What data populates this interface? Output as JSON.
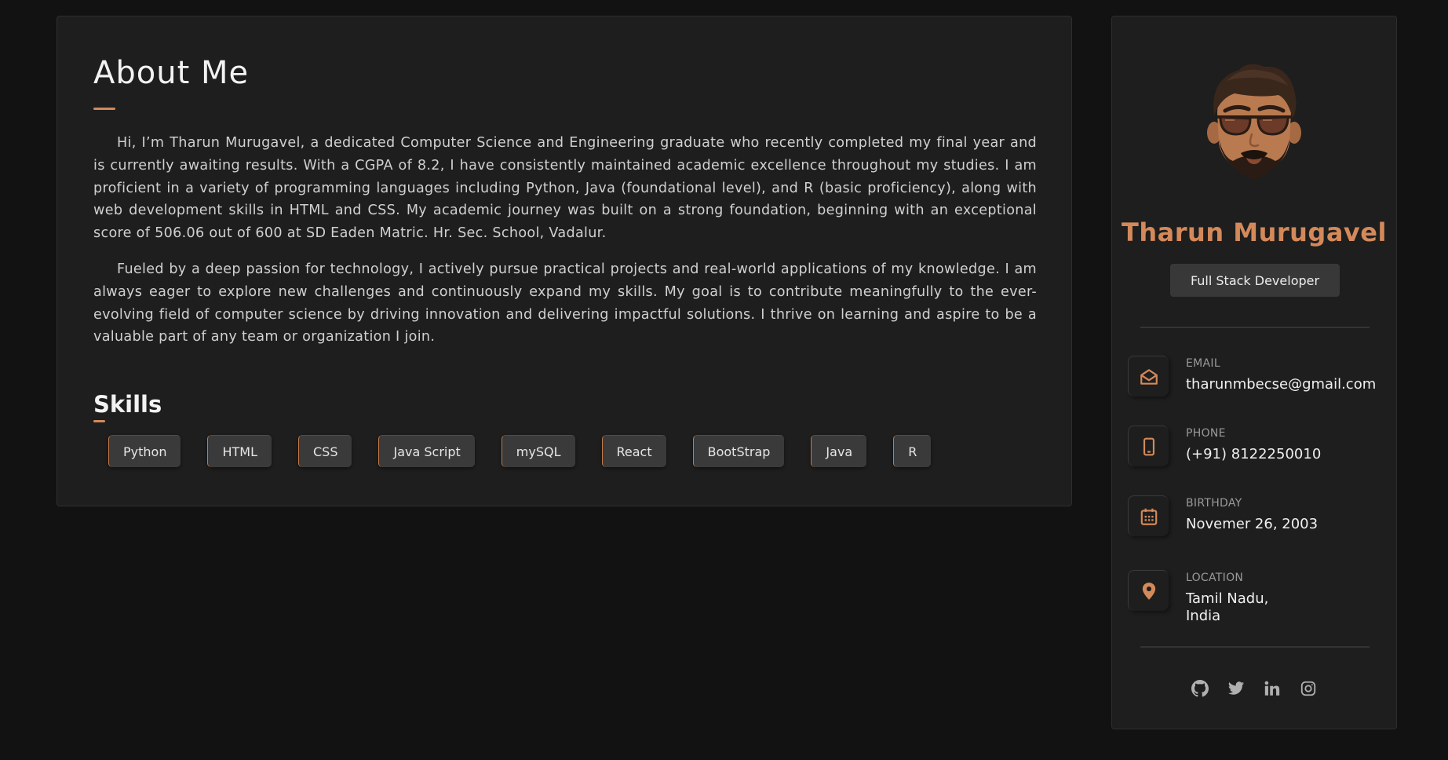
{
  "about": {
    "title": "About Me",
    "paragraphs": [
      "Hi, I’m Tharun Murugavel, a dedicated Computer Science and Engineering graduate who recently completed my final year and is currently awaiting results. With a CGPA of 8.2, I have consistently maintained academic excellence throughout my studies. I am proficient in a variety of programming languages including Python, Java (foundational level), and R (basic proficiency), along with web development skills in HTML and CSS. My academic journey was built on a strong foundation, beginning with an exceptional score of 506.06 out of 600 at SD Eaden Matric. Hr. Sec. School, Vadalur.",
      "Fueled by a deep passion for technology, I actively pursue practical projects and real-world applications of my knowledge. I am always eager to explore new challenges and continuously expand my skills. My goal is to contribute meaningfully to the ever-evolving field of computer science by driving innovation and delivering impactful solutions. I thrive on learning and aspire to be a valuable part of any team or organization I join."
    ]
  },
  "skills": {
    "title": "Skills",
    "items": [
      "Python",
      "HTML",
      "CSS",
      "Java Script",
      "mySQL",
      "React",
      "BootStrap",
      "Java",
      "R"
    ]
  },
  "profile": {
    "name": "Tharun Murugavel",
    "role": "Full Stack Developer",
    "contacts": [
      {
        "label": "Email",
        "value": "tharunmbecse@gmail.com",
        "icon": "mail-open-icon"
      },
      {
        "label": "Phone",
        "value": "(+91) 8122250010",
        "icon": "phone-icon"
      },
      {
        "label": "Birthday",
        "value": "Novemer 26, 2003",
        "icon": "calendar-icon"
      },
      {
        "label": "Location",
        "value": "Tamil Nadu,\nIndia",
        "icon": "location-pin-icon"
      }
    ],
    "social": [
      "github-icon",
      "twitter-icon",
      "linkedin-icon",
      "instagram-icon"
    ]
  },
  "colors": {
    "accent": "#d4895a",
    "background": "#121212",
    "card": "#1e1e1e"
  }
}
